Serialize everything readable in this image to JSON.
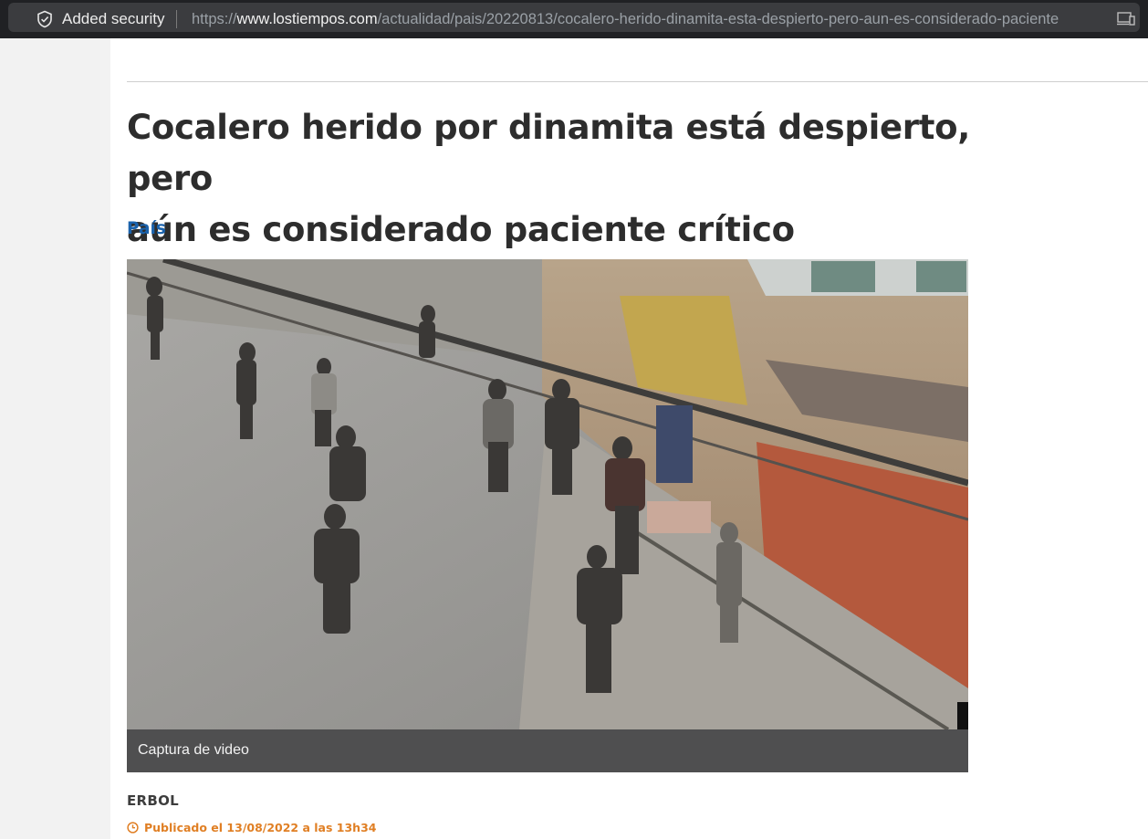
{
  "browser": {
    "security_label": "Added security",
    "url_scheme": "https://",
    "url_host": "www.lostiempos.com",
    "url_path": "/actualidad/pais/20220813/cocalero-herido-dinamita-esta-despierto-pero-aun-es-considerado-paciente",
    "security_icon": "shield-check-icon",
    "device_icon": "pc-icon"
  },
  "article": {
    "headline_line1": "Cocalero herido por dinamita está despierto, pero",
    "headline_line2": "aún es considerado paciente crítico",
    "section": "País",
    "photo_caption": "Captura de video",
    "author": "ERBOL",
    "published": "Publicado el 13/08/2022 a las 13h34"
  },
  "colors": {
    "section_link": "#1a62ac",
    "published_text": "#e07f24",
    "headline": "#2d2d2d"
  }
}
